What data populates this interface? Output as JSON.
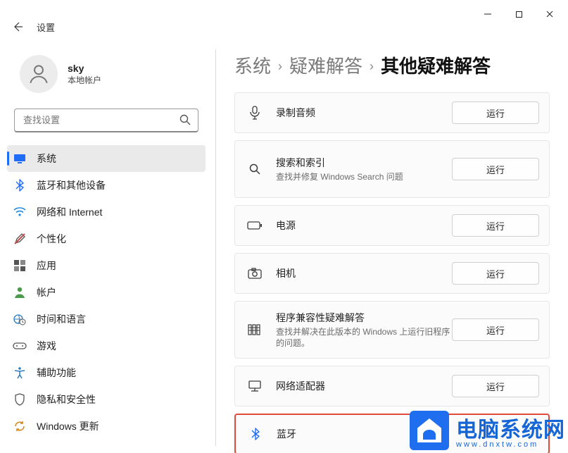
{
  "app_title": "设置",
  "user": {
    "name": "sky",
    "account_type": "本地帐户"
  },
  "search": {
    "placeholder": "查找设置"
  },
  "nav": {
    "items": [
      {
        "label": "系统",
        "icon": "monitor",
        "selected": true
      },
      {
        "label": "蓝牙和其他设备",
        "icon": "bluetooth"
      },
      {
        "label": "网络和 Internet",
        "icon": "wifi"
      },
      {
        "label": "个性化",
        "icon": "brush"
      },
      {
        "label": "应用",
        "icon": "apps"
      },
      {
        "label": "帐户",
        "icon": "person"
      },
      {
        "label": "时间和语言",
        "icon": "globe-clock"
      },
      {
        "label": "游戏",
        "icon": "gamepad"
      },
      {
        "label": "辅助功能",
        "icon": "accessibility"
      },
      {
        "label": "隐私和安全性",
        "icon": "shield"
      },
      {
        "label": "Windows 更新",
        "icon": "update"
      }
    ]
  },
  "breadcrumb": {
    "parts": [
      "系统",
      "疑难解答"
    ],
    "current": "其他疑难解答"
  },
  "tiles": [
    {
      "title": "录制音频",
      "sub": "",
      "icon": "microphone",
      "action": "运行"
    },
    {
      "title": "搜索和索引",
      "sub": "查找并修复 Windows Search 问题",
      "icon": "search",
      "action": "运行"
    },
    {
      "title": "电源",
      "sub": "",
      "icon": "battery",
      "action": "运行"
    },
    {
      "title": "相机",
      "sub": "",
      "icon": "camera",
      "action": "运行"
    },
    {
      "title": "程序兼容性疑难解答",
      "sub": "查找并解决在此版本的 Windows 上运行旧程序的问题。",
      "icon": "compat",
      "action": "运行"
    },
    {
      "title": "网络适配器",
      "sub": "",
      "icon": "network",
      "action": "运行"
    },
    {
      "title": "蓝牙",
      "sub": "",
      "icon": "bluetooth",
      "action": "",
      "highlight": true
    }
  ],
  "watermark": {
    "main": "电脑系统网",
    "sub": "www.dnxtw.com"
  }
}
